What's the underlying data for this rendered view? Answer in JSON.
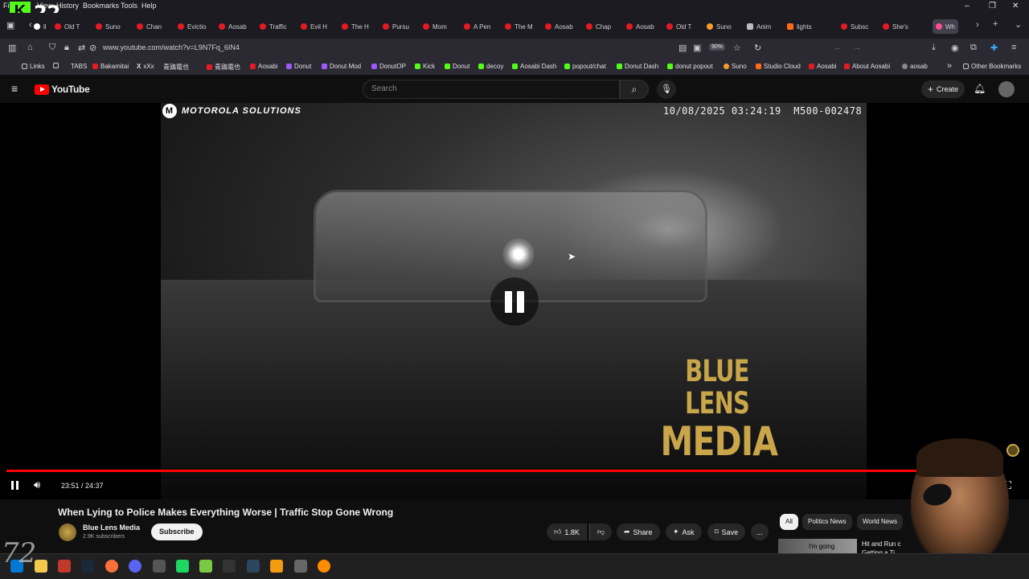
{
  "browser": {
    "menu": [
      "File",
      "View",
      "History",
      "Bookmarks",
      "Tools",
      "Help"
    ],
    "kick_badge": "K",
    "kick_count": "22",
    "tabs": [
      "Old T",
      "Suno",
      "Chan",
      "Evictio",
      "Aosab",
      "Traffic",
      "Evil H",
      "The H",
      "Pursu",
      "Mom",
      "A Pen",
      "The M",
      "Aosab",
      "Chap",
      "Aosab",
      "Old T",
      "Suno",
      "Anim",
      "lights",
      "Subsc",
      "She's",
      "Wh"
    ],
    "url": "www.youtube.com/watch?v=L9N7Fq_6IN4",
    "zoom": "90%",
    "bookmarks": [
      "Links",
      "TABS",
      "Bakamitai",
      "xXx",
      "青鶏電也",
      "青鶏電也",
      "Aosabi",
      "Donut",
      "Donut Mod",
      "DonutOP",
      "Kick",
      "Donut",
      "decoy",
      "Aosabi Dash",
      "popout/chat",
      "Donut Dash",
      "donut popout",
      "Suno",
      "Studio Cloud",
      "Aosabi",
      "About Aosabi",
      "aosab",
      "Other Bookmarks"
    ]
  },
  "youtube": {
    "logo_text": "YouTube",
    "search_placeholder": "Search",
    "create_label": "Create"
  },
  "video": {
    "overlay_brand": "MOTOROLA SOLUTIONS",
    "bwc_stamp": "10/08/2025 03:24:19  M500-002478",
    "watermark_line1": "BLUE LENS",
    "watermark_line2": "MEDIA",
    "time_display": "23:51 / 24:37",
    "progress": 0.969
  },
  "meta": {
    "title": "When Lying to Police Makes Everything Worse | Traffic Stop Gone Wrong",
    "channel": "Blue Lens Media",
    "subscribers": "2.9K subscribers",
    "subscribe_label": "Subscribe",
    "likes": "1.8K",
    "share_label": "Share",
    "ask_label": "Ask",
    "save_label": "Save",
    "more_label": "..."
  },
  "sidebar": {
    "chips": [
      "All",
      "Politics News",
      "World News"
    ],
    "rec_thumb_text": "I'm going",
    "rec_title": "Hit and Run c Getting a Ti"
  },
  "colors": {
    "accent": "#ff0000",
    "watermark": "#c9a64a",
    "bg": "#0f0f0f"
  }
}
